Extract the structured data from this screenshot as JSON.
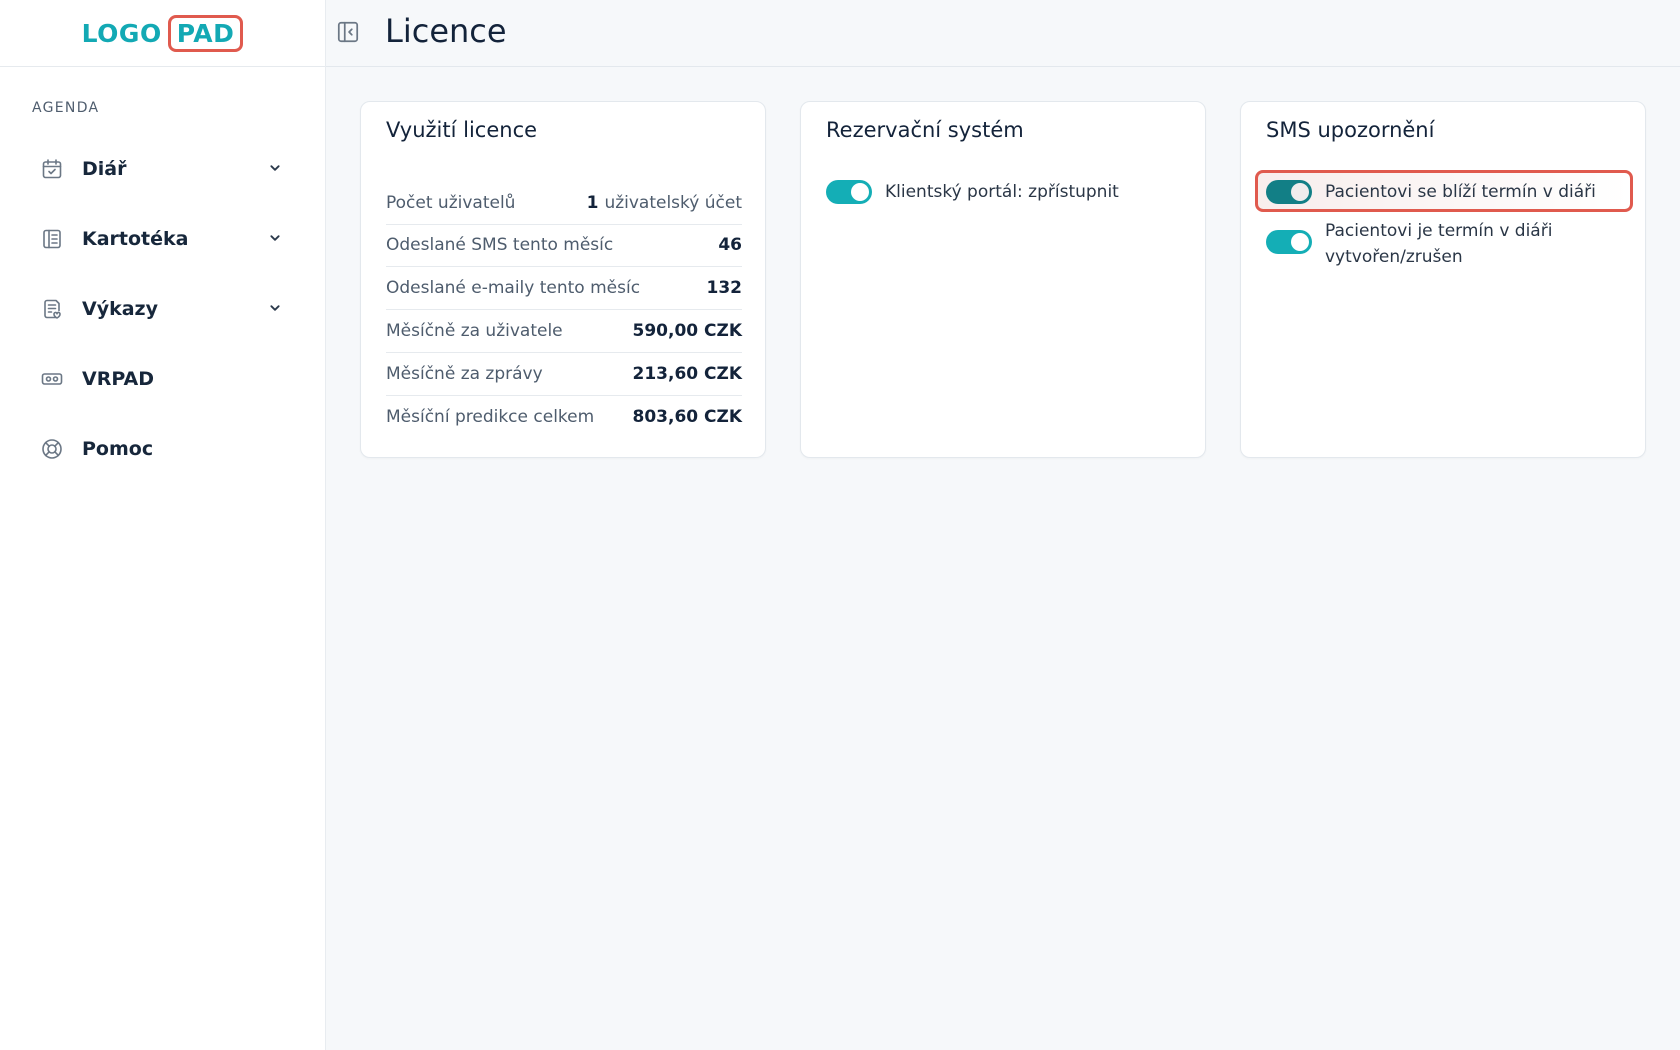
{
  "logo": {
    "part1": "LOGO",
    "part2": "PAD"
  },
  "sidebar": {
    "section_label": "AGENDA",
    "items": [
      {
        "label": "Diář",
        "icon": "calendar-check-icon",
        "has_chevron": true
      },
      {
        "label": "Kartotéka",
        "icon": "card-file-icon",
        "has_chevron": true
      },
      {
        "label": "Výkazy",
        "icon": "report-icon",
        "has_chevron": true
      },
      {
        "label": "VRPAD",
        "icon": "vr-headset-icon",
        "has_chevron": false
      },
      {
        "label": "Pomoc",
        "icon": "lifebuoy-icon",
        "has_chevron": false
      }
    ]
  },
  "header": {
    "title": "Licence",
    "collapse_icon": "sidebar-collapse-icon"
  },
  "license_card": {
    "title": "Využití licence",
    "rows": [
      {
        "key": "Počet uživatelů",
        "value": "1",
        "unit": "uživatelský účet"
      },
      {
        "key": "Odeslané SMS tento měsíc",
        "value": "46"
      },
      {
        "key": "Odeslané e-maily tento měsíc",
        "value": "132"
      },
      {
        "key": "Měsíčně za uživatele",
        "value": "590,00 CZK"
      },
      {
        "key": "Měsíčně za zprávy",
        "value": "213,60 CZK"
      },
      {
        "key": "Měsíční predikce celkem",
        "value": "803,60 CZK"
      }
    ]
  },
  "reservation_card": {
    "title": "Rezervační systém",
    "toggles": [
      {
        "label": "Klientský portál: zpřístupnit",
        "on": true
      }
    ]
  },
  "sms_card": {
    "title": "SMS upozornění",
    "toggles": [
      {
        "label": "Pacientovi se blíží termín v diáři",
        "on": true
      },
      {
        "label": "Pacientovi je termín v diáři vytvořen/zrušen",
        "on": true
      }
    ]
  },
  "colors": {
    "accent": "#14aeb6",
    "highlight_border": "#e05a4e",
    "text_dark": "#13233a"
  }
}
